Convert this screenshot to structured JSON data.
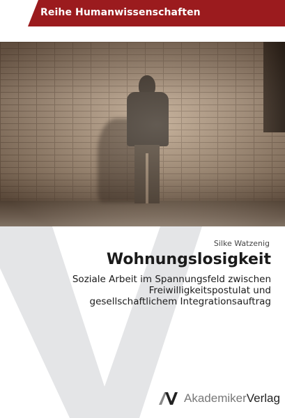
{
  "series": "Reihe Humanwissenschaften",
  "author": "Silke Watzenig",
  "title": "Wohnungslosigkeit",
  "subtitle": "Soziale Arbeit im Spannungsfeld zwischen Freiwilligkeitspostulat und gesellschaftlichem Integrationsauftrag",
  "publisher": {
    "part1": "Akademiker",
    "part2": "Verlag"
  },
  "colors": {
    "banner": "#9b1b1e",
    "v_shape": "#e4e5e7"
  }
}
